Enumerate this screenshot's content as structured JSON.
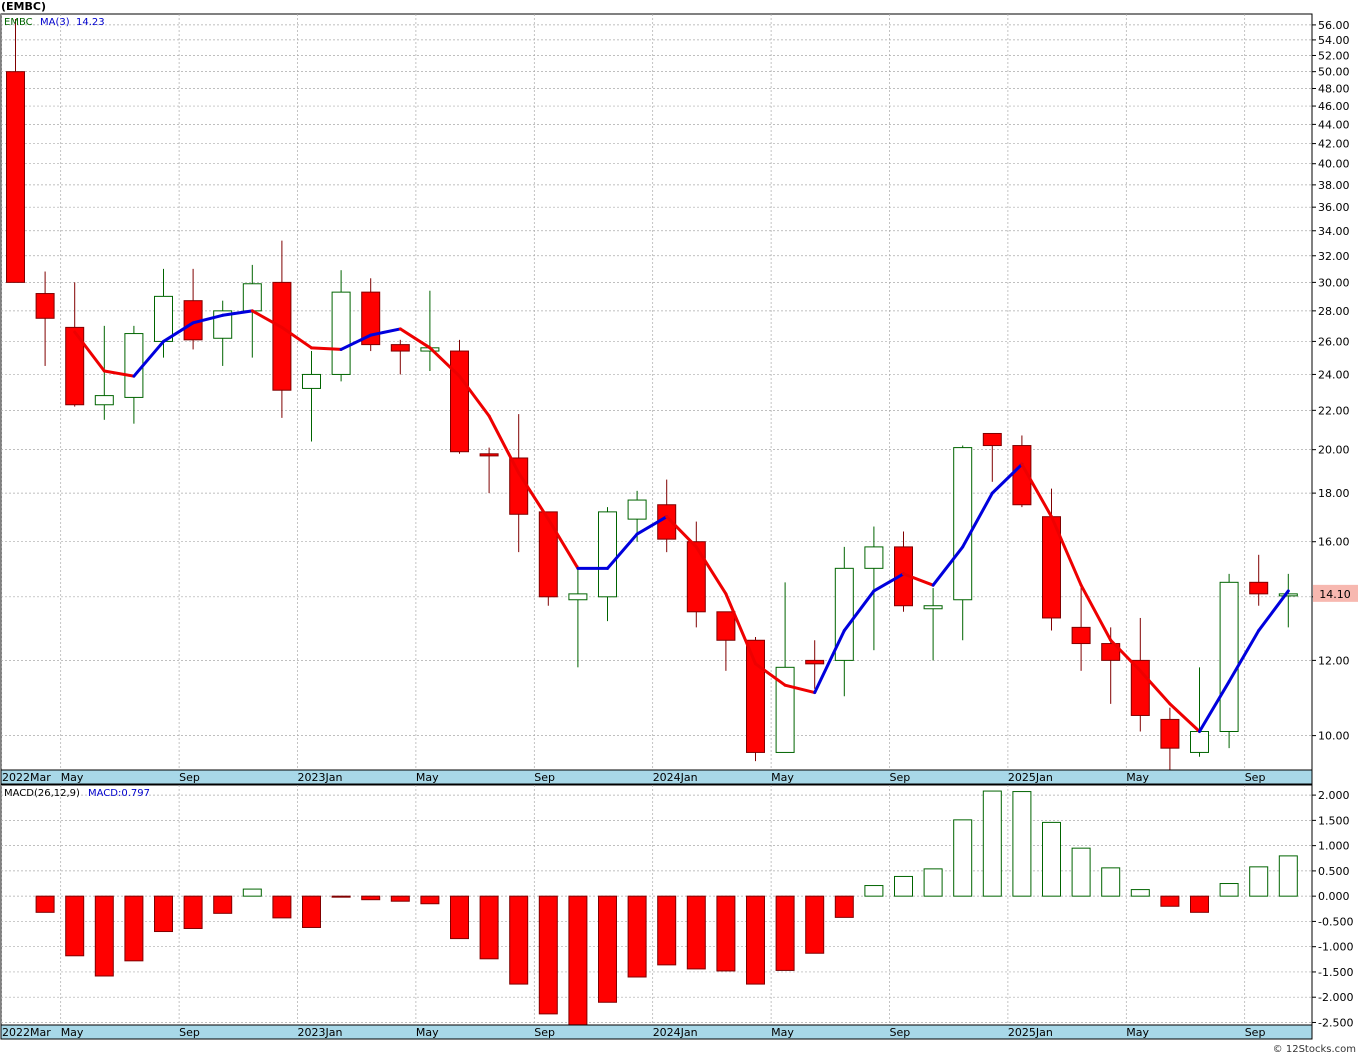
{
  "header": {
    "symbol": "(EMBC)"
  },
  "price_panel": {
    "ticker_tag": "EMBC",
    "ma_label": "MA(3)",
    "ma_value": "14.23",
    "last_price_label": "14.10"
  },
  "macd_panel": {
    "label": "MACD(26,12,9)",
    "value_label": "MACD:0.797"
  },
  "watermark": "© 12Stocks.com",
  "colors": {
    "down": "#ff0000",
    "up_outline": "#006400",
    "ma_up": "#0000dd",
    "ma_down": "#ee0000",
    "axis_band": "#a8d8e8",
    "last_price_bg": "#f7b8b0"
  },
  "chart_data": [
    {
      "type": "candlestick",
      "scale": "log",
      "ylim": [
        9.2,
        57.5
      ],
      "y_ticks": [
        "10.00",
        "12.00",
        "14.00",
        "16.00",
        "18.00",
        "20.00",
        "22.00",
        "24.00",
        "26.00",
        "28.00",
        "30.00",
        "32.00",
        "34.00",
        "36.00",
        "38.00",
        "40.00",
        "42.00",
        "44.00",
        "46.00",
        "48.00",
        "50.00",
        "52.00",
        "54.00",
        "56.00"
      ],
      "x_tick_labels": [
        {
          "label": "2022Mar",
          "i": 0
        },
        {
          "label": "May",
          "i": 2
        },
        {
          "label": "Sep",
          "i": 6
        },
        {
          "label": "2023Jan",
          "i": 10
        },
        {
          "label": "May",
          "i": 14
        },
        {
          "label": "Sep",
          "i": 18
        },
        {
          "label": "2024Jan",
          "i": 22
        },
        {
          "label": "May",
          "i": 26
        },
        {
          "label": "Sep",
          "i": 30
        },
        {
          "label": "2025Jan",
          "i": 34
        },
        {
          "label": "May",
          "i": 38
        },
        {
          "label": "Sep",
          "i": 42
        }
      ],
      "candles": [
        {
          "o": 50.0,
          "h": 56.8,
          "l": 30.0,
          "c": 30.0
        },
        {
          "o": 29.2,
          "h": 30.8,
          "l": 24.5,
          "c": 27.5
        },
        {
          "o": 26.9,
          "h": 30.0,
          "l": 22.2,
          "c": 22.3
        },
        {
          "o": 22.3,
          "h": 27.0,
          "l": 21.5,
          "c": 22.8
        },
        {
          "o": 22.7,
          "h": 27.0,
          "l": 21.3,
          "c": 26.5
        },
        {
          "o": 26.0,
          "h": 31.0,
          "l": 25.0,
          "c": 29.0
        },
        {
          "o": 28.7,
          "h": 31.0,
          "l": 25.5,
          "c": 26.1
        },
        {
          "o": 26.2,
          "h": 28.7,
          "l": 24.5,
          "c": 28.0
        },
        {
          "o": 28.0,
          "h": 31.3,
          "l": 25.0,
          "c": 29.9
        },
        {
          "o": 30.0,
          "h": 33.2,
          "l": 21.6,
          "c": 23.1
        },
        {
          "o": 23.2,
          "h": 25.4,
          "l": 20.4,
          "c": 24.0
        },
        {
          "o": 24.0,
          "h": 30.9,
          "l": 23.6,
          "c": 29.3
        },
        {
          "o": 29.3,
          "h": 30.3,
          "l": 25.4,
          "c": 25.8
        },
        {
          "o": 25.8,
          "h": 26.1,
          "l": 24.0,
          "c": 25.4
        },
        {
          "o": 25.4,
          "h": 29.4,
          "l": 24.2,
          "c": 25.6
        },
        {
          "o": 25.4,
          "h": 26.1,
          "l": 19.8,
          "c": 19.9
        },
        {
          "o": 19.8,
          "h": 20.1,
          "l": 18.0,
          "c": 19.7
        },
        {
          "o": 19.6,
          "h": 21.8,
          "l": 15.6,
          "c": 17.1
        },
        {
          "o": 17.2,
          "h": 17.2,
          "l": 13.7,
          "c": 14.0
        },
        {
          "o": 13.9,
          "h": 15.1,
          "l": 11.8,
          "c": 14.1
        },
        {
          "o": 14.0,
          "h": 17.4,
          "l": 13.2,
          "c": 17.2
        },
        {
          "o": 16.9,
          "h": 18.1,
          "l": 16.0,
          "c": 17.7
        },
        {
          "o": 17.5,
          "h": 18.6,
          "l": 15.6,
          "c": 16.1
        },
        {
          "o": 16.0,
          "h": 16.8,
          "l": 13.0,
          "c": 13.5
        },
        {
          "o": 13.5,
          "h": 13.5,
          "l": 11.7,
          "c": 12.6
        },
        {
          "o": 12.6,
          "h": 12.7,
          "l": 9.4,
          "c": 9.6
        },
        {
          "o": 9.6,
          "h": 14.5,
          "l": 9.6,
          "c": 11.8
        },
        {
          "o": 12.0,
          "h": 12.6,
          "l": 11.2,
          "c": 11.9
        },
        {
          "o": 12.0,
          "h": 15.8,
          "l": 11.0,
          "c": 15.0
        },
        {
          "o": 15.0,
          "h": 16.6,
          "l": 12.3,
          "c": 15.8
        },
        {
          "o": 15.8,
          "h": 16.4,
          "l": 13.5,
          "c": 13.7
        },
        {
          "o": 13.6,
          "h": 14.3,
          "l": 12.0,
          "c": 13.7
        },
        {
          "o": 13.9,
          "h": 20.2,
          "l": 12.6,
          "c": 20.1
        },
        {
          "o": 20.8,
          "h": 20.8,
          "l": 18.5,
          "c": 20.2
        },
        {
          "o": 20.2,
          "h": 20.7,
          "l": 17.4,
          "c": 17.5
        },
        {
          "o": 17.0,
          "h": 18.2,
          "l": 12.9,
          "c": 13.3
        },
        {
          "o": 13.0,
          "h": 14.4,
          "l": 11.7,
          "c": 12.5
        },
        {
          "o": 12.5,
          "h": 13.0,
          "l": 10.8,
          "c": 12.0
        },
        {
          "o": 12.0,
          "h": 13.3,
          "l": 10.1,
          "c": 10.5
        },
        {
          "o": 10.4,
          "h": 10.7,
          "l": 9.2,
          "c": 9.7
        },
        {
          "o": 9.6,
          "h": 11.8,
          "l": 9.5,
          "c": 10.1
        },
        {
          "o": 10.1,
          "h": 14.8,
          "l": 9.7,
          "c": 14.5
        },
        {
          "o": 14.5,
          "h": 15.5,
          "l": 13.7,
          "c": 14.1
        },
        {
          "o": 14.1,
          "h": 14.8,
          "l": 13.0,
          "c": 14.1
        }
      ],
      "ma3": [
        null,
        null,
        26.6,
        24.2,
        23.9,
        26.0,
        27.2,
        27.7,
        28.0,
        26.9,
        25.6,
        25.5,
        26.4,
        26.8,
        25.6,
        23.9,
        21.7,
        18.9,
        16.9,
        15.0,
        15.0,
        16.3,
        17.0,
        15.8,
        14.1,
        11.9,
        11.3,
        11.1,
        12.9,
        14.2,
        14.8,
        14.4,
        15.8,
        18.0,
        19.3,
        17.0,
        14.4,
        12.6,
        11.7,
        10.8,
        10.1,
        11.4,
        12.9,
        14.2
      ]
    },
    {
      "type": "bar",
      "title": "MACD(26,12,9)",
      "ylim": [
        -2.55,
        2.2
      ],
      "y_ticks": [
        "-2.500",
        "-2.000",
        "-1.500",
        "-1.000",
        "-0.500",
        "0.000",
        "0.500",
        "1.000",
        "1.500",
        "2.000"
      ],
      "values": [
        null,
        -0.32,
        -1.18,
        -1.58,
        -1.28,
        -0.7,
        -0.64,
        -0.34,
        0.14,
        -0.43,
        -0.62,
        -0.02,
        -0.07,
        -0.1,
        -0.15,
        -0.84,
        -1.24,
        -1.74,
        -2.33,
        -2.55,
        -2.1,
        -1.6,
        -1.36,
        -1.44,
        -1.48,
        -1.74,
        -1.47,
        -1.13,
        -0.42,
        0.21,
        0.39,
        0.54,
        1.51,
        2.08,
        2.07,
        1.46,
        0.95,
        0.56,
        0.13,
        -0.2,
        -0.32,
        0.25,
        0.58,
        0.797
      ]
    }
  ]
}
